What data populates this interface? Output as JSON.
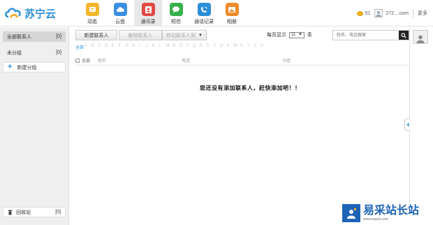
{
  "app": {
    "logo_text": "苏宁云"
  },
  "nav": [
    {
      "label": "动态",
      "icon": "activity-icon",
      "color": "#f3b52a"
    },
    {
      "label": "云盘",
      "icon": "cloud-icon",
      "color": "#3b8fe0"
    },
    {
      "label": "通讯录",
      "icon": "contacts-icon",
      "color": "#e24a44",
      "active": true
    },
    {
      "label": "短信",
      "icon": "sms-icon",
      "color": "#37b14b"
    },
    {
      "label": "通话记录",
      "icon": "call-log-icon",
      "color": "#2b8fd8"
    },
    {
      "label": "相册",
      "icon": "photo-icon",
      "color": "#f08a2b"
    }
  ],
  "user": {
    "coins": "51",
    "username": "272....com",
    "more": "更多"
  },
  "sidebar": {
    "items": [
      {
        "label": "全部联系人",
        "count": "[0]",
        "active": true
      },
      {
        "label": "未分组",
        "count": "[0]"
      }
    ],
    "add_group": "新建分组",
    "recycle": {
      "label": "回收站",
      "count": "[0]"
    }
  },
  "toolbar": {
    "new_contact": "新建联系人",
    "delete_contact": "删除联系人",
    "move_contact": "移动联系人到"
  },
  "pagination": {
    "label": "每页显示",
    "value": "11",
    "unit": "条"
  },
  "search": {
    "placeholder": "姓名、电话搜索"
  },
  "letters": [
    "全部",
    "A",
    "B",
    "C",
    "D",
    "E",
    "F",
    "G",
    "H",
    "I",
    "J",
    "K",
    "L",
    "M",
    "N",
    "O",
    "P",
    "Q",
    "R",
    "S",
    "T",
    "U",
    "V",
    "W",
    "X",
    "Y",
    "Z",
    "#"
  ],
  "table": {
    "select_all": "全选",
    "headers": [
      "姓名",
      "电话",
      "分组"
    ]
  },
  "empty_message": "您还没有添加联系人，赶快添加吧！！",
  "watermark": {
    "title": "易采站长站",
    "sub": "www.easck.com"
  },
  "colors": {
    "accent": "#2b8fd8",
    "active_tab": "#e8e8e8"
  }
}
